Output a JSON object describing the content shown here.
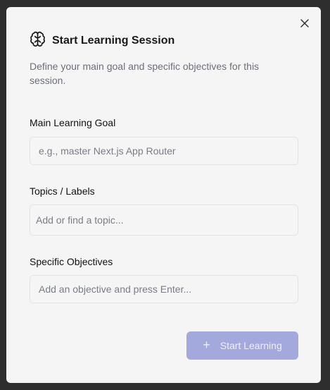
{
  "dialog": {
    "title": "Start Learning Session",
    "description": "Define your main goal and specific objectives for this session.",
    "close_icon": "close-icon",
    "header_icon": "brain-icon"
  },
  "goal": {
    "label": "Main Learning Goal",
    "placeholder": "e.g., master Next.js App Router",
    "value": ""
  },
  "topics": {
    "label": "Topics / Labels",
    "placeholder": "Add or find a topic...",
    "value": ""
  },
  "objectives": {
    "label": "Specific Objectives",
    "placeholder": "Add an objective and press Enter...",
    "value": ""
  },
  "actions": {
    "start_label": "Start Learning",
    "start_icon": "plus-icon",
    "start_color": "#a3a9dc",
    "start_disabled": true
  }
}
